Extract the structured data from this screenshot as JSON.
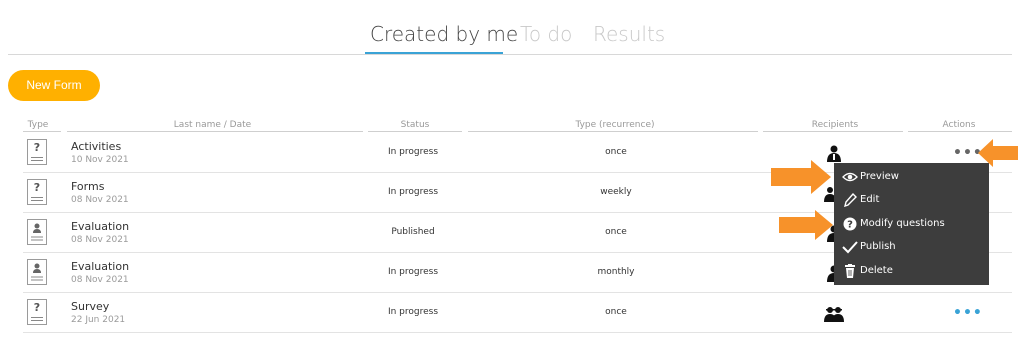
{
  "tabs": [
    {
      "label": "Created by me",
      "active": true
    },
    {
      "label": "To do",
      "active": false
    },
    {
      "label": "Results",
      "active": false
    }
  ],
  "toolbar": {
    "new_form_label": "New Form"
  },
  "table": {
    "headers": [
      "Type",
      "Last name / Date",
      "Status",
      "Type (recurrence)",
      "Recipients",
      "Actions"
    ],
    "rows": [
      {
        "name": "Activities",
        "date": "10 Nov 2021",
        "status": "In progress",
        "recurrence": "once",
        "icon": "question-doc-icon"
      },
      {
        "name": "Forms",
        "date": "08 Nov 2021",
        "status": "In progress",
        "recurrence": "weekly",
        "icon": "question-doc-icon"
      },
      {
        "name": "Evaluation",
        "date": "08 Nov 2021",
        "status": "Published",
        "recurrence": "once",
        "icon": "evaluation-doc-icon"
      },
      {
        "name": "Evaluation",
        "date": "08 Nov 2021",
        "status": "In progress",
        "recurrence": "monthly",
        "icon": "evaluation-doc-icon"
      },
      {
        "name": "Survey",
        "date": "22 Jun 2021",
        "status": "In progress",
        "recurrence": "once",
        "icon": "question-doc-icon"
      }
    ]
  },
  "context_menu": {
    "items": [
      {
        "label": "Preview",
        "icon": "eye-icon"
      },
      {
        "label": "Edit",
        "icon": "pencil-icon"
      },
      {
        "label": "Modify questions",
        "icon": "question-circle-icon"
      },
      {
        "label": "Publish",
        "icon": "checkmark-icon"
      },
      {
        "label": "Delete",
        "icon": "trash-icon"
      }
    ]
  },
  "colors": {
    "accent": "#3aa3d6",
    "button": "#ffb000",
    "menu_bg": "#3d3d3d",
    "arrow": "#f7922a"
  }
}
